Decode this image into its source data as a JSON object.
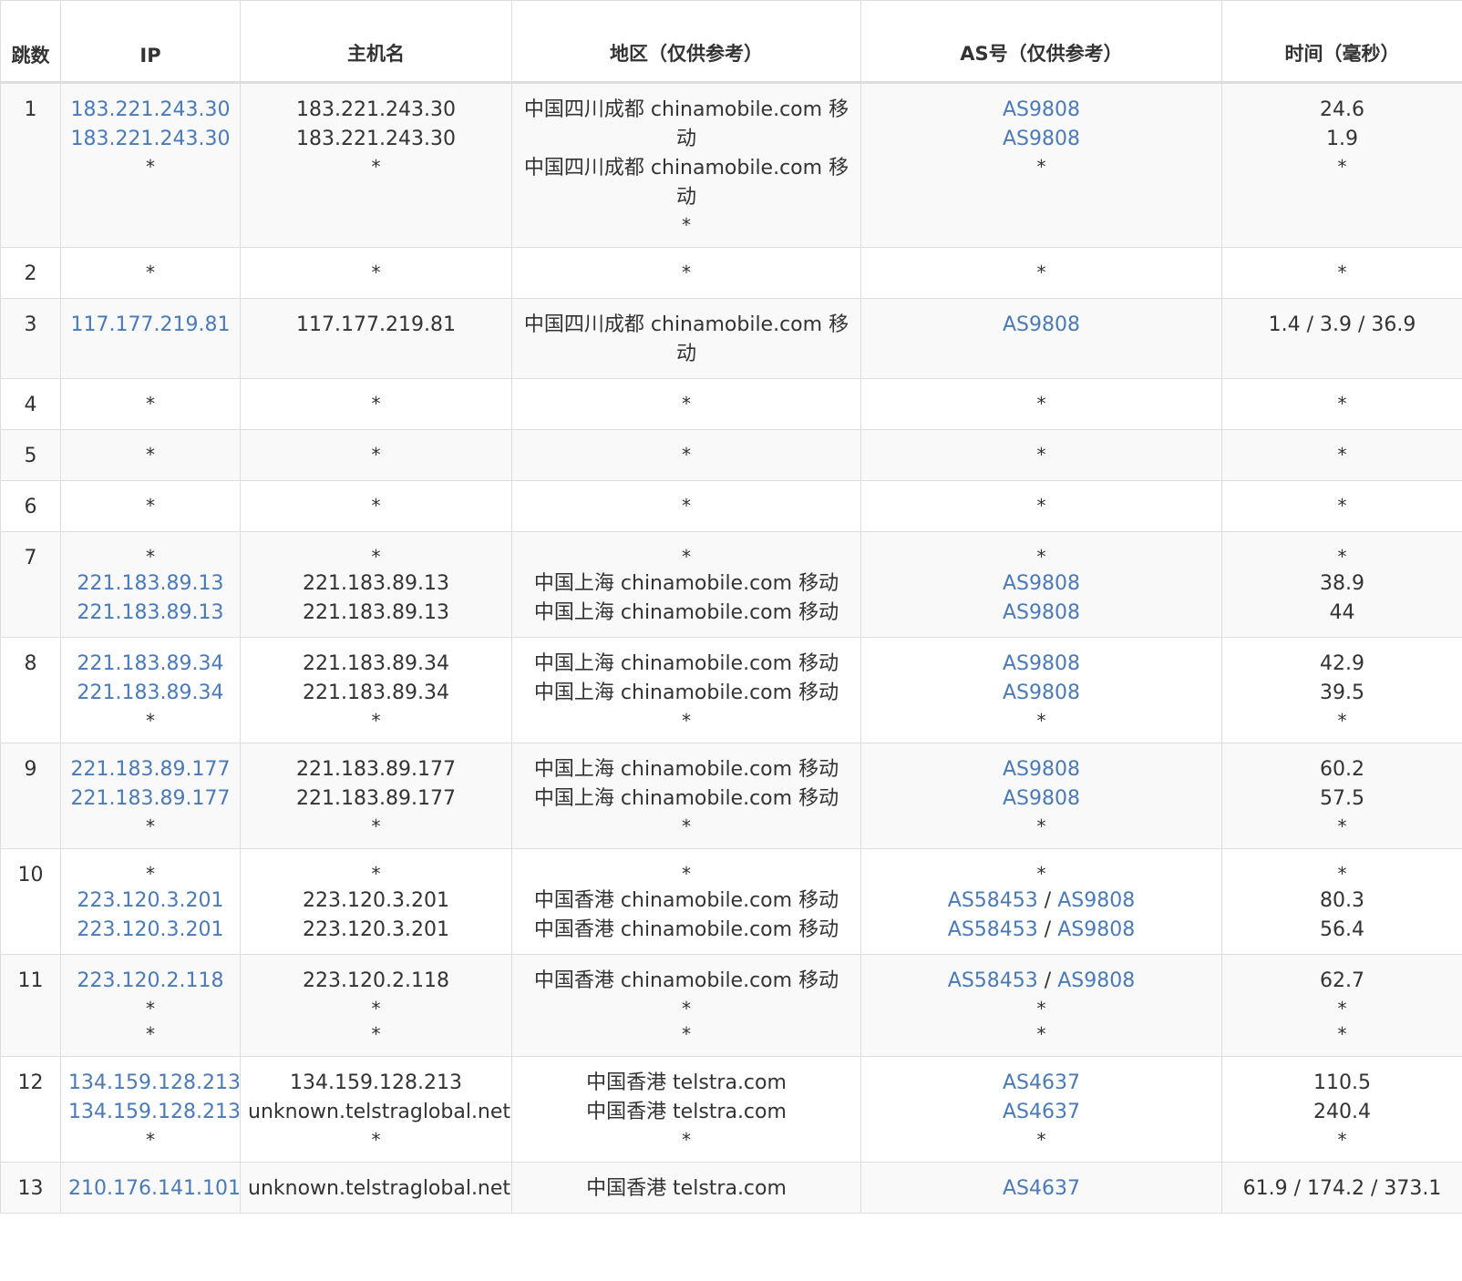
{
  "headers": {
    "hop": "跳数",
    "ip": "IP",
    "hostname": "主机名",
    "location": "地区（仅供参考）",
    "asn": "AS号（仅供参考）",
    "time": "时间（毫秒）"
  },
  "rows": [
    {
      "hop": "1",
      "ip": [
        "183.221.243.30",
        "183.221.243.30",
        "*"
      ],
      "hostname": [
        "183.221.243.30",
        "183.221.243.30",
        "*"
      ],
      "location": [
        "中国四川成都 chinamobile.com 移动",
        "中国四川成都 chinamobile.com 移动",
        "*"
      ],
      "asn": [
        [
          "AS9808"
        ],
        [
          "AS9808"
        ],
        []
      ],
      "time": [
        "24.6",
        "1.9",
        "*"
      ]
    },
    {
      "hop": "2",
      "ip": [
        "*"
      ],
      "hostname": [
        "*"
      ],
      "location": [
        "*"
      ],
      "asn": [
        []
      ],
      "time": [
        "*"
      ]
    },
    {
      "hop": "3",
      "ip": [
        "117.177.219.81"
      ],
      "hostname": [
        "117.177.219.81"
      ],
      "location": [
        "中国四川成都 chinamobile.com 移动"
      ],
      "asn": [
        [
          "AS9808"
        ]
      ],
      "time": [
        "1.4 / 3.9 / 36.9"
      ]
    },
    {
      "hop": "4",
      "ip": [
        "*"
      ],
      "hostname": [
        "*"
      ],
      "location": [
        "*"
      ],
      "asn": [
        []
      ],
      "time": [
        "*"
      ]
    },
    {
      "hop": "5",
      "ip": [
        "*"
      ],
      "hostname": [
        "*"
      ],
      "location": [
        "*"
      ],
      "asn": [
        []
      ],
      "time": [
        "*"
      ]
    },
    {
      "hop": "6",
      "ip": [
        "*"
      ],
      "hostname": [
        "*"
      ],
      "location": [
        "*"
      ],
      "asn": [
        []
      ],
      "time": [
        "*"
      ]
    },
    {
      "hop": "7",
      "ip": [
        "*",
        "221.183.89.13",
        "221.183.89.13"
      ],
      "hostname": [
        "*",
        "221.183.89.13",
        "221.183.89.13"
      ],
      "location": [
        "*",
        "中国上海 chinamobile.com 移动",
        "中国上海 chinamobile.com 移动"
      ],
      "asn": [
        [],
        [
          "AS9808"
        ],
        [
          "AS9808"
        ]
      ],
      "time": [
        "*",
        "38.9",
        "44"
      ]
    },
    {
      "hop": "8",
      "ip": [
        "221.183.89.34",
        "221.183.89.34",
        "*"
      ],
      "hostname": [
        "221.183.89.34",
        "221.183.89.34",
        "*"
      ],
      "location": [
        "中国上海 chinamobile.com 移动",
        "中国上海 chinamobile.com 移动",
        "*"
      ],
      "asn": [
        [
          "AS9808"
        ],
        [
          "AS9808"
        ],
        []
      ],
      "time": [
        "42.9",
        "39.5",
        "*"
      ]
    },
    {
      "hop": "9",
      "ip": [
        "221.183.89.177",
        "221.183.89.177",
        "*"
      ],
      "hostname": [
        "221.183.89.177",
        "221.183.89.177",
        "*"
      ],
      "location": [
        "中国上海 chinamobile.com 移动",
        "中国上海 chinamobile.com 移动",
        "*"
      ],
      "asn": [
        [
          "AS9808"
        ],
        [
          "AS9808"
        ],
        []
      ],
      "time": [
        "60.2",
        "57.5",
        "*"
      ]
    },
    {
      "hop": "10",
      "ip": [
        "*",
        "223.120.3.201",
        "223.120.3.201"
      ],
      "hostname": [
        "*",
        "223.120.3.201",
        "223.120.3.201"
      ],
      "location": [
        "*",
        "中国香港 chinamobile.com 移动",
        "中国香港 chinamobile.com 移动"
      ],
      "asn": [
        [],
        [
          "AS58453",
          "AS9808"
        ],
        [
          "AS58453",
          "AS9808"
        ]
      ],
      "time": [
        "*",
        "80.3",
        "56.4"
      ]
    },
    {
      "hop": "11",
      "ip": [
        "223.120.2.118",
        "*",
        "*"
      ],
      "hostname": [
        "223.120.2.118",
        "*",
        "*"
      ],
      "location": [
        "中国香港 chinamobile.com 移动",
        "*",
        "*"
      ],
      "asn": [
        [
          "AS58453",
          "AS9808"
        ],
        [],
        []
      ],
      "time": [
        "62.7",
        "*",
        "*"
      ]
    },
    {
      "hop": "12",
      "ip": [
        "134.159.128.213",
        "134.159.128.213",
        "*"
      ],
      "hostname": [
        "134.159.128.213",
        "unknown.telstraglobal.net",
        "*"
      ],
      "location": [
        "中国香港 telstra.com",
        "中国香港 telstra.com",
        "*"
      ],
      "asn": [
        [
          "AS4637"
        ],
        [
          "AS4637"
        ],
        []
      ],
      "time": [
        "110.5",
        "240.4",
        "*"
      ]
    },
    {
      "hop": "13",
      "ip": [
        "210.176.141.101"
      ],
      "hostname": [
        "unknown.telstraglobal.net"
      ],
      "location": [
        "中国香港 telstra.com"
      ],
      "asn": [
        [
          "AS4637"
        ]
      ],
      "time": [
        "61.9 / 174.2 / 373.1"
      ]
    }
  ]
}
